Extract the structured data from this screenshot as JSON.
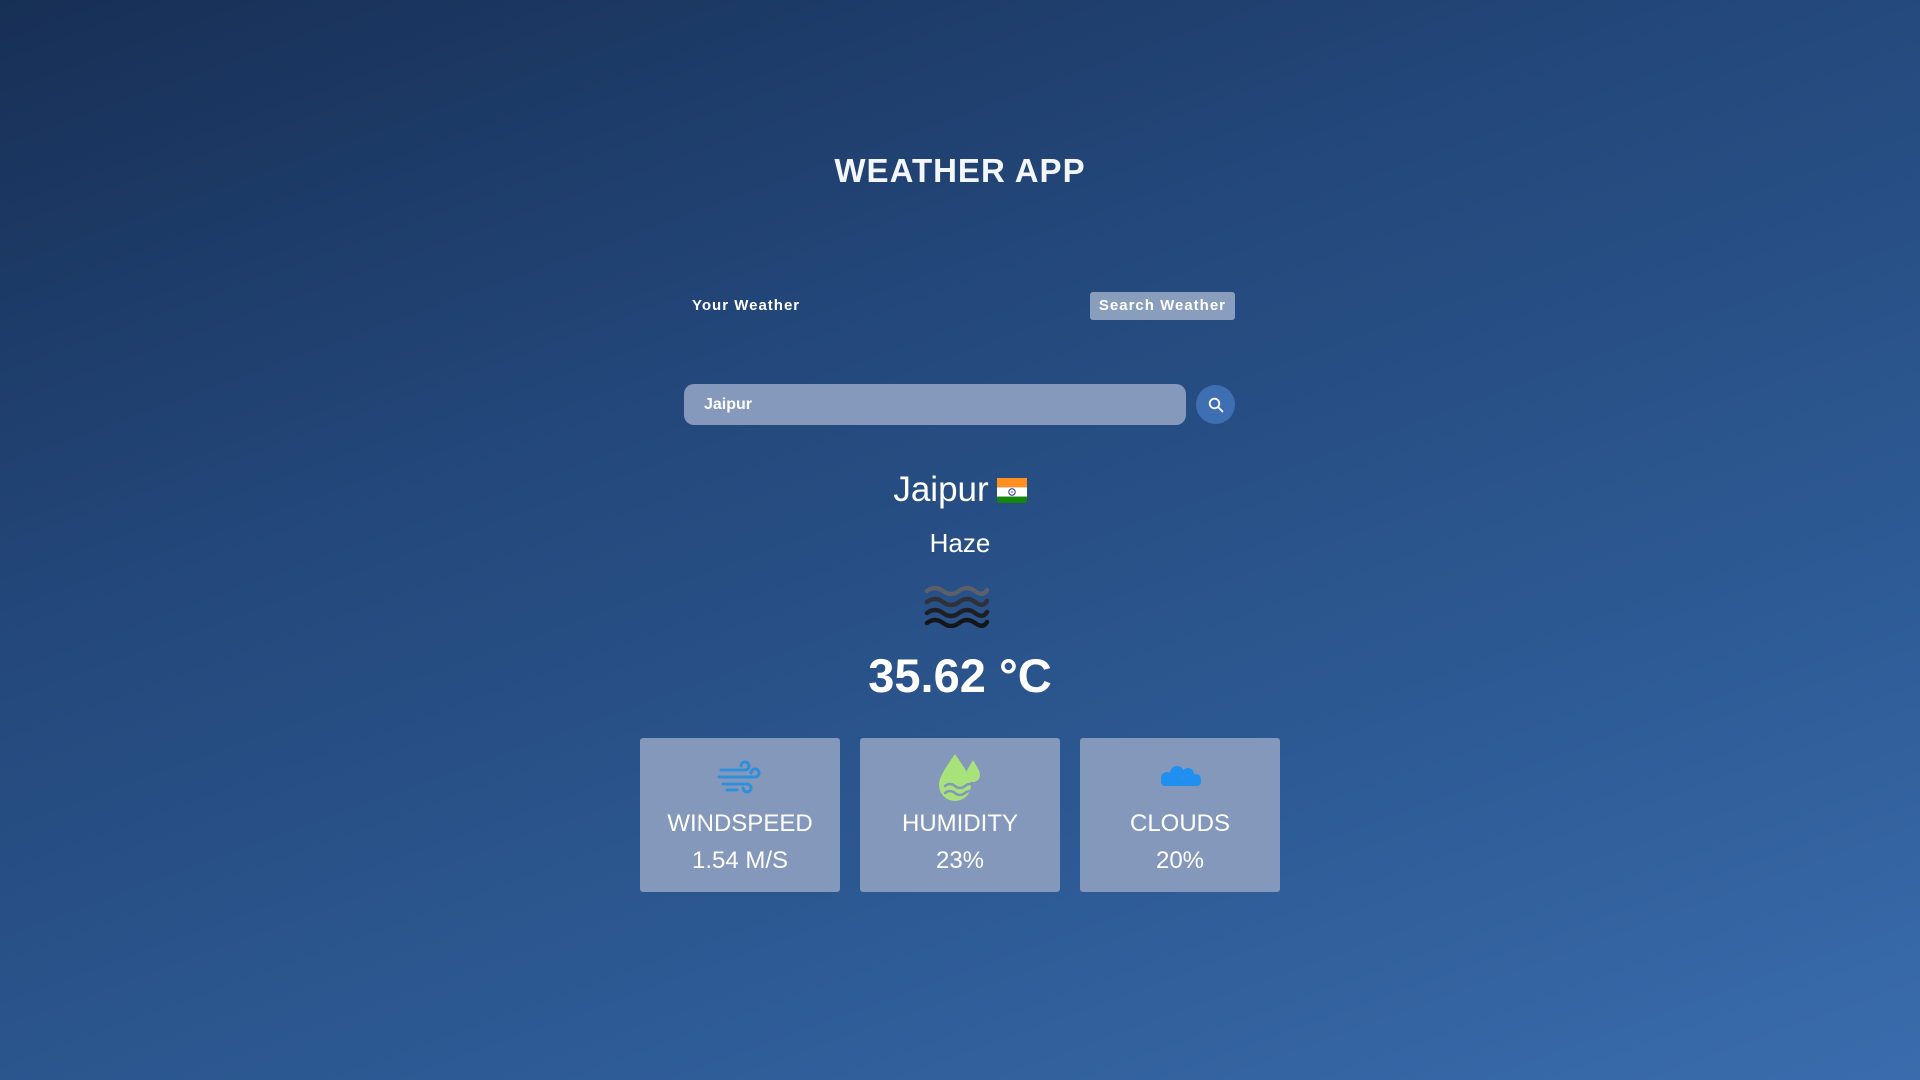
{
  "app": {
    "title": "WEATHER APP"
  },
  "tabs": [
    {
      "label": "Your Weather",
      "active": false
    },
    {
      "label": "Search Weather",
      "active": true
    }
  ],
  "search": {
    "value": "Jaipur",
    "placeholder": "",
    "button_icon": "search-icon"
  },
  "weather": {
    "city": "Jaipur",
    "country_flag_icon": "india-flag-icon",
    "condition": "Haze",
    "condition_icon": "haze-icon",
    "temperature": "35.62 °C"
  },
  "stats": [
    {
      "icon": "wind-icon",
      "label": "WINDSPEED",
      "value": "1.54 M/S"
    },
    {
      "icon": "humidity-icon",
      "label": "HUMIDITY",
      "value": "23%"
    },
    {
      "icon": "cloud-icon",
      "label": "CLOUDS",
      "value": "20%"
    }
  ],
  "colors": {
    "background_top": "#172f55",
    "background_bottom": "#3a6cad",
    "card_background": "#8498bb",
    "search_button": "#3f6fb3",
    "wind_icon": "#2f8fd8",
    "humidity_icon": "#a8e27a",
    "cloud_icon": "#1f8ff0"
  }
}
